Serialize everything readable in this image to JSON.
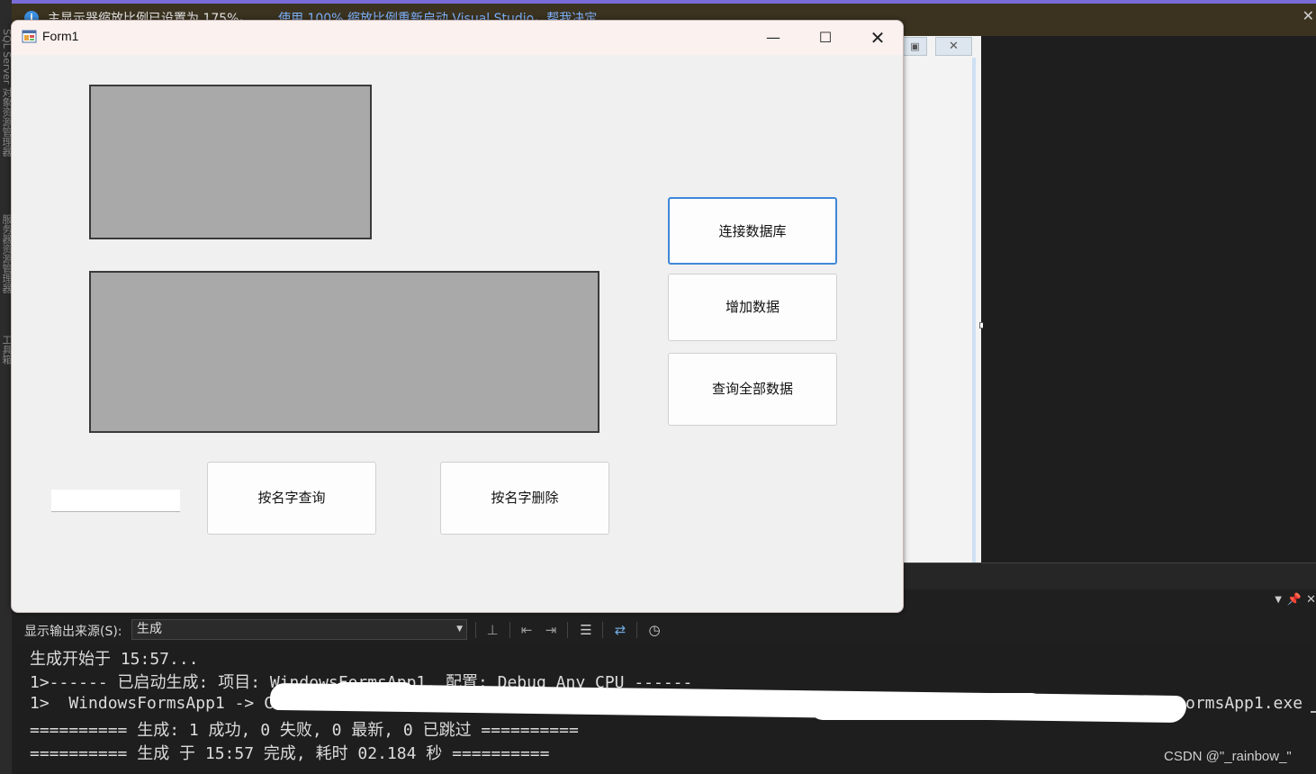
{
  "vs": {
    "side_labels": [
      "SQL Server 对象资源管理器",
      "服务器资源管理器",
      "工具箱"
    ],
    "info_bar": {
      "message": "主显示器缩放比例已设置为 175%。",
      "link": "使用 100% 缩放比例重新启动 Visual Studio。帮我决定"
    }
  },
  "form": {
    "title": "Form1",
    "buttons": {
      "connect": "连接数据库",
      "add": "增加数据",
      "query_all": "查询全部数据",
      "query_by_name": "按名字查询",
      "delete_by_name": "按名字删除"
    },
    "name_input_value": ""
  },
  "output": {
    "source_label": "显示输出来源(S):",
    "source_value": "生成",
    "lines": [
      "生成开始于 15:57...",
      "1>------ 已启动生成: 项目: WindowsFormsApp1, 配置: Debug Any CPU ------",
      "1>  WindowsFormsApp1 -> C",
      "ormsApp1.exe",
      "========== 生成: 1 成功, 0 失败, 0 最新, 0 已跳过 ==========",
      "========== 生成 于 15:57 完成, 耗时 02.184 秒 =========="
    ]
  },
  "watermark": "CSDN @\"_rainbow_\"",
  "colors": {
    "accent_blue": "#3f87d8",
    "info_bar_bg": "#3b3320",
    "output_bg": "#1e1e1e"
  }
}
